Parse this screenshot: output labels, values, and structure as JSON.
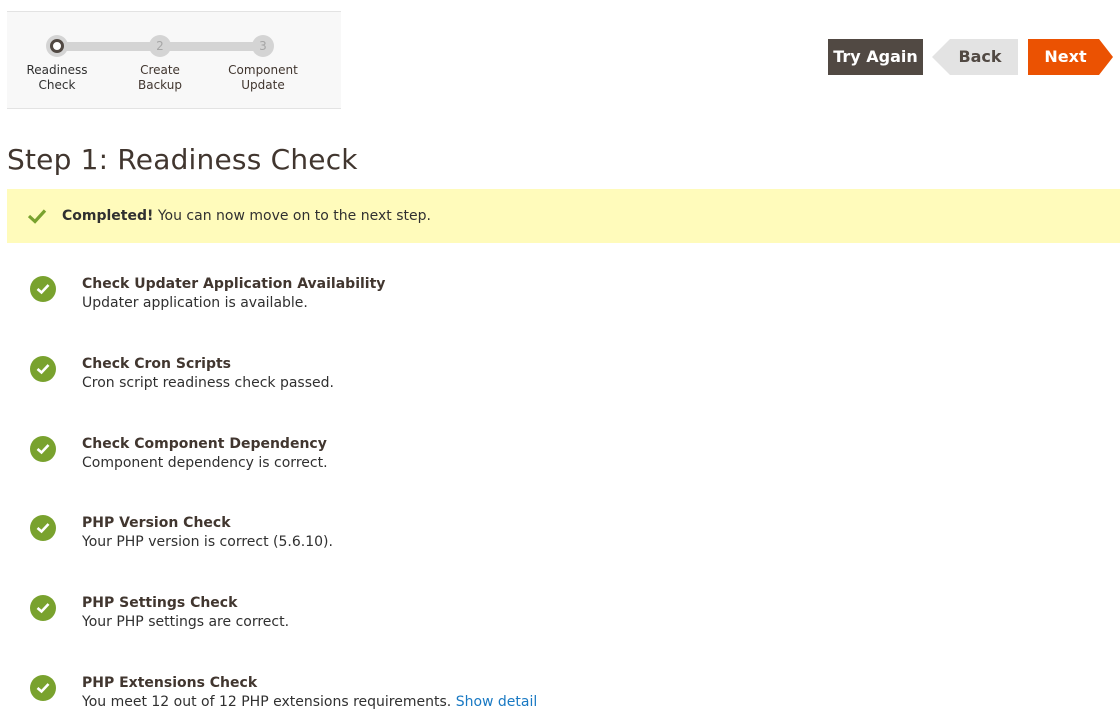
{
  "progress": {
    "steps": [
      {
        "number": "",
        "label_line1": "Readiness",
        "label_line2": "Check",
        "state": "active"
      },
      {
        "number": "2",
        "label_line1": "Create",
        "label_line2": "Backup",
        "state": "pending"
      },
      {
        "number": "3",
        "label_line1": "Component",
        "label_line2": "Update",
        "state": "pending"
      }
    ]
  },
  "actions": {
    "try_again": "Try Again",
    "back": "Back",
    "next": "Next"
  },
  "page": {
    "title": "Step 1: Readiness Check"
  },
  "message": {
    "strong": "Completed!",
    "text": " You can now move on to the next step.",
    "icon": "checkmark-icon"
  },
  "checks": [
    {
      "name": "Check Updater Application Availability",
      "desc": "Updater application is available.",
      "status": "success"
    },
    {
      "name": "Check Cron Scripts",
      "desc": "Cron script readiness check passed.",
      "status": "success"
    },
    {
      "name": "Check Component Dependency",
      "desc": "Component dependency is correct.",
      "status": "success"
    },
    {
      "name": "PHP Version Check",
      "desc": "Your PHP version is correct (5.6.10).",
      "status": "success"
    },
    {
      "name": "PHP Settings Check",
      "desc": "Your PHP settings are correct.",
      "status": "success"
    },
    {
      "name": "PHP Extensions Check",
      "desc": "You meet 12 out of 12 PHP extensions requirements. ",
      "link": "Show detail",
      "status": "success"
    }
  ],
  "colors": {
    "accent": "#eb5202",
    "success": "#79a22e",
    "message_bg": "#fffbbb",
    "dark_button": "#514943",
    "link": "#1979c3"
  }
}
